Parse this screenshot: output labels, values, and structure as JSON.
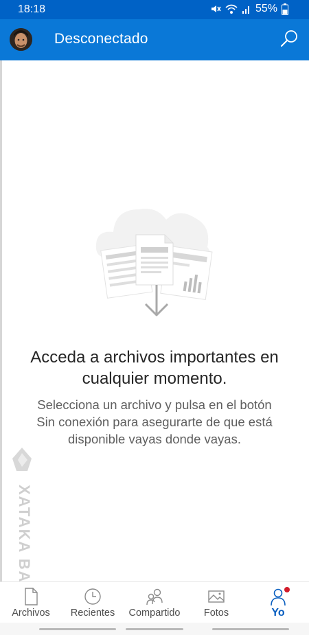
{
  "status_bar": {
    "time": "18:18",
    "battery": "55%",
    "icons": [
      "mute-icon",
      "wifi-icon",
      "signal-icon",
      "battery-icon"
    ]
  },
  "app_bar": {
    "title": "Desconectado",
    "background": "#0a78d7",
    "status_background": "#0062c6"
  },
  "empty_state": {
    "heading_line1": "Acceda a archivos importantes en",
    "heading_line2": "cualquier momento.",
    "body_line1": "Selecciona un archivo y pulsa en el botón",
    "body_line2": "Sin conexión para asegurarte de que está",
    "body_line3": "disponible vayas donde vayas."
  },
  "watermark": {
    "text": "XATAKA BASICS"
  },
  "bottom_nav": {
    "items": [
      {
        "label": "Archivos",
        "icon": "file-icon",
        "active": false
      },
      {
        "label": "Recientes",
        "icon": "clock-icon",
        "active": false
      },
      {
        "label": "Compartido",
        "icon": "shared-people-icon",
        "active": false
      },
      {
        "label": "Fotos",
        "icon": "photo-icon",
        "active": false
      },
      {
        "label": "Yo",
        "icon": "person-icon",
        "active": true
      }
    ],
    "active_color": "#0a5fc0",
    "badge_color": "#d21c2b"
  }
}
